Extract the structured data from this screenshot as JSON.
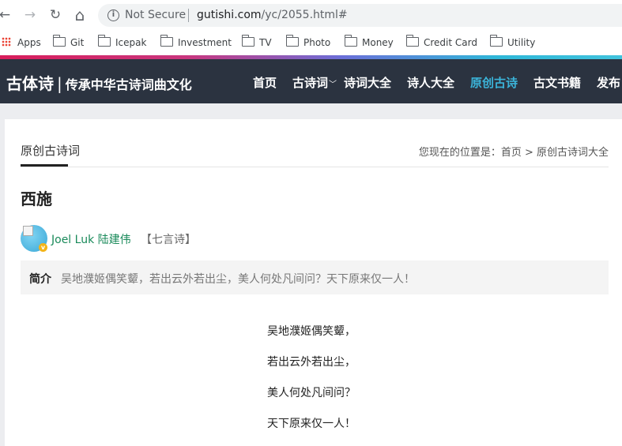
{
  "browser": {
    "back_icon": "←",
    "forward_icon": "→",
    "reload_icon": "↻",
    "home_icon": "⌂",
    "info_icon": "i",
    "security_text": "Not Secure",
    "url_host": "gutishi.com",
    "url_path": "/yc/2055.html#"
  },
  "bookmarks": [
    {
      "label": "Apps"
    },
    {
      "label": "Git"
    },
    {
      "label": "Icepak"
    },
    {
      "label": "Investment"
    },
    {
      "label": "TV"
    },
    {
      "label": "Photo"
    },
    {
      "label": "Money"
    },
    {
      "label": "Credit Card"
    },
    {
      "label": "Utility"
    }
  ],
  "site": {
    "logo": "古体诗",
    "logo_divider": "|",
    "slogan": "传承中华古诗词曲文化",
    "nav": [
      {
        "label": "首页"
      },
      {
        "label": "古诗词",
        "caret": "﹀"
      },
      {
        "label": "诗词大全"
      },
      {
        "label": "诗人大全"
      },
      {
        "label": "原创古诗"
      },
      {
        "label": "古文书籍"
      },
      {
        "label": "发布"
      }
    ],
    "active_color": "#3bb4d9",
    "header_bg": "#2b3340"
  },
  "content": {
    "section_tab": "原创古诗词",
    "breadcrumb": "您现在的位置是：首页 > 原创古诗词大全",
    "title": "西施",
    "verified_badge": "v",
    "author": "Joel Luk 陆建伟",
    "genre": "【七言诗】",
    "intro_label": "简介",
    "intro_text": "吴地濮姬偶笑颦，若出云外若出尘，美人何处凡间问？天下原来仅一人！",
    "poem_lines": [
      "吴地濮姬偶笑颦，",
      "若出云外若出尘，",
      "美人何处凡间问？",
      "天下原来仅一人！"
    ]
  }
}
